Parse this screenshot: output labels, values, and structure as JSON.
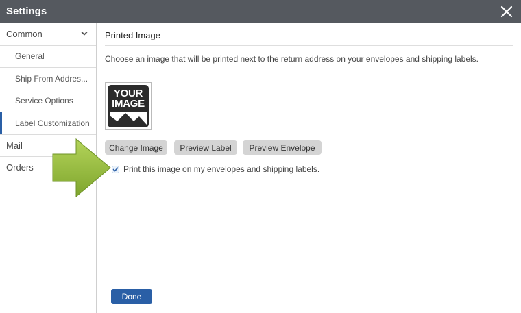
{
  "window": {
    "title": "Settings",
    "close_icon": "close-icon"
  },
  "sidebar": {
    "items": [
      {
        "label": "Common",
        "level": "top",
        "expanded": true
      },
      {
        "label": "General",
        "level": "sub"
      },
      {
        "label": "Ship From Addres...",
        "level": "sub"
      },
      {
        "label": "Service Options",
        "level": "sub"
      },
      {
        "label": "Label Customization",
        "level": "sub",
        "active": true
      },
      {
        "label": "Mail",
        "level": "top"
      },
      {
        "label": "Orders",
        "level": "top"
      }
    ]
  },
  "main": {
    "section_title": "Printed Image",
    "description": "Choose an image that will be printed next to the return address on your envelopes and shipping labels.",
    "image": {
      "line1": "YOUR",
      "line2": "IMAGE"
    },
    "buttons": {
      "change_image": "Change Image",
      "preview_label": "Preview Label",
      "preview_envelope": "Preview Envelope"
    },
    "print_checkbox": {
      "label": "Print this image on my envelopes and shipping labels.",
      "checked": true
    },
    "done_button": "Done"
  },
  "colors": {
    "titlebar": "#55595f",
    "accent": "#2a5fa6",
    "arrow": "#8db53a"
  }
}
